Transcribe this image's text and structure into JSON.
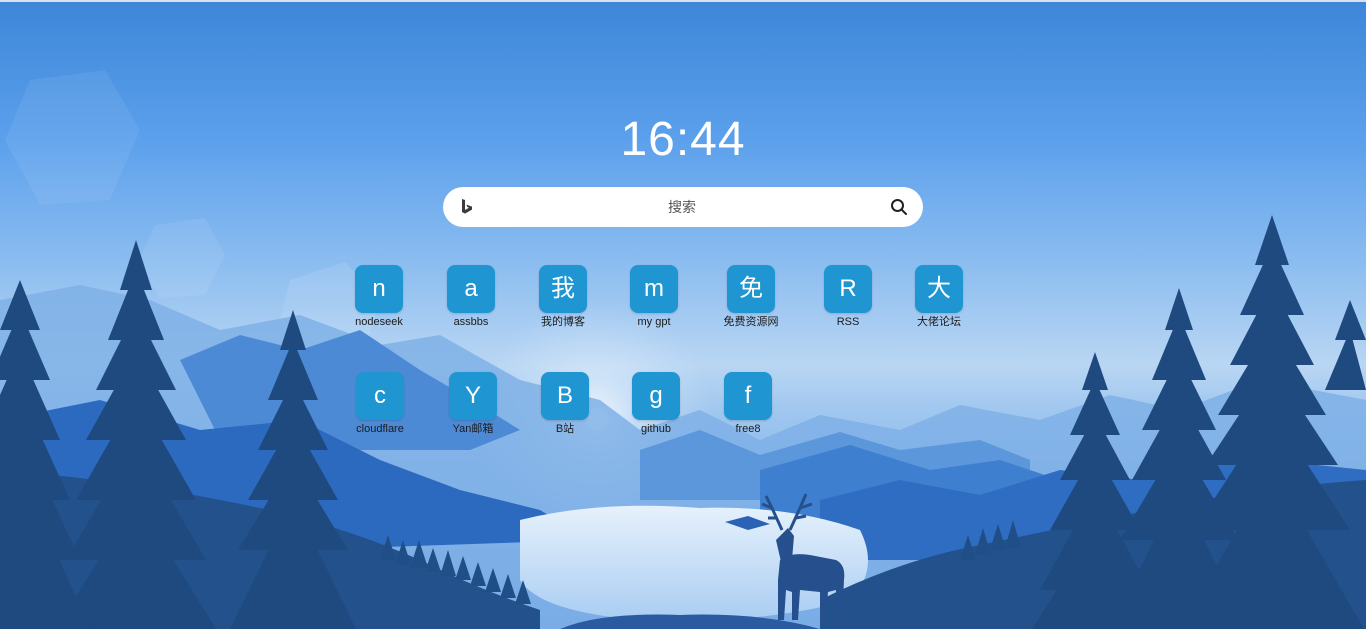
{
  "clock": {
    "time": "16:44"
  },
  "search": {
    "placeholder": "搜索",
    "engine_icon": "bing-icon",
    "button_icon": "search-icon"
  },
  "shortcuts": [
    {
      "letter": "n",
      "label": "nodeseek"
    },
    {
      "letter": "a",
      "label": "assbbs"
    },
    {
      "letter": "我",
      "label": "我的博客"
    },
    {
      "letter": "m",
      "label": "my gpt"
    },
    {
      "letter": "免",
      "label": "免费资源网"
    },
    {
      "letter": "R",
      "label": "RSS"
    },
    {
      "letter": "大",
      "label": "大佬论坛"
    },
    {
      "letter": "c",
      "label": "cloudflare"
    },
    {
      "letter": "Y",
      "label": "Yan邮箱"
    },
    {
      "letter": "B",
      "label": "B站"
    },
    {
      "letter": "g",
      "label": "github"
    },
    {
      "letter": "f",
      "label": "free8"
    }
  ],
  "colors": {
    "tile": "#1f96d2",
    "sky_top": "#3d86d8",
    "forest_dark": "#1f4f86"
  }
}
